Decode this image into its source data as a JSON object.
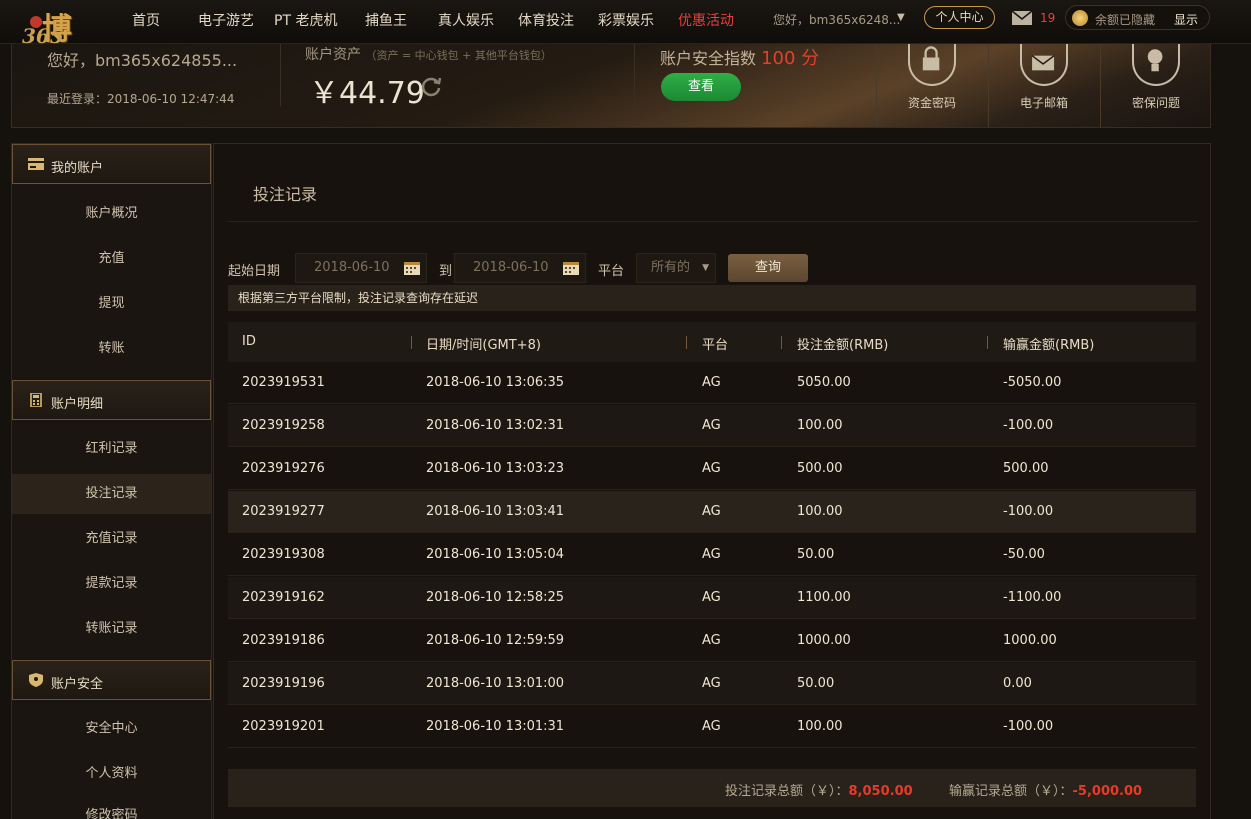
{
  "logo": {
    "big": "博",
    "small": "365"
  },
  "nav": {
    "items": [
      "首页",
      "电子游艺",
      "PT 老虎机",
      "捕鱼王",
      "真人娱乐",
      "体育投注",
      "彩票娱乐",
      "优惠活动"
    ],
    "greeting": "您好，bm365x6248...",
    "personal_center": "个人中心",
    "mail_count": "19",
    "balance_hidden": "余额已隐藏",
    "show_label": "显示"
  },
  "account": {
    "hello": "您好，bm365x624855...",
    "last_login": "最近登录：2018-06-10 12:47:44",
    "assets_label": "账户资产",
    "assets_sub": "（资产 = 中心钱包 + 其他平台钱包）",
    "amount": "￥44.79",
    "safety_label": "账户安全指数",
    "safety_score": "100 分",
    "check_button": "查看",
    "panels": [
      "资金密码",
      "电子邮箱",
      "密保问题"
    ]
  },
  "sidebar": {
    "sections": [
      {
        "title": "我的账户",
        "items": [
          "账户概况",
          "充值",
          "提现",
          "转账"
        ]
      },
      {
        "title": "账户明细",
        "items": [
          "红利记录",
          "投注记录",
          "充值记录",
          "提款记录",
          "转账记录"
        ]
      },
      {
        "title": "账户安全",
        "items": [
          "安全中心",
          "个人资料",
          "修改密码"
        ]
      }
    ],
    "active_item": "投注记录"
  },
  "main": {
    "title": "投注记录",
    "filter": {
      "start_label": "起始日期",
      "start_value": "2018-06-10",
      "to_label": "到",
      "end_value": "2018-06-10",
      "platform_label": "平台",
      "platform_value": "所有的",
      "query_button": "查询"
    },
    "notice": "根据第三方平台限制，投注记录查询存在延迟",
    "columns": [
      "ID",
      "日期/时间(GMT+8)",
      "平台",
      "投注金额(RMB)",
      "输赢金额(RMB)"
    ],
    "rows": [
      [
        "2023919531",
        "2018-06-10 13:06:35",
        "AG",
        "5050.00",
        "-5050.00"
      ],
      [
        "2023919258",
        "2018-06-10 13:02:31",
        "AG",
        "100.00",
        "-100.00"
      ],
      [
        "2023919276",
        "2018-06-10 13:03:23",
        "AG",
        "500.00",
        "500.00"
      ],
      [
        "2023919277",
        "2018-06-10 13:03:41",
        "AG",
        "100.00",
        "-100.00"
      ],
      [
        "2023919308",
        "2018-06-10 13:05:04",
        "AG",
        "50.00",
        "-50.00"
      ],
      [
        "2023919162",
        "2018-06-10 12:58:25",
        "AG",
        "1100.00",
        "-1100.00"
      ],
      [
        "2023919186",
        "2018-06-10 12:59:59",
        "AG",
        "1000.00",
        "1000.00"
      ],
      [
        "2023919196",
        "2018-06-10 13:01:00",
        "AG",
        "50.00",
        "0.00"
      ],
      [
        "2023919201",
        "2018-06-10 13:01:31",
        "AG",
        "100.00",
        "-100.00"
      ]
    ],
    "summary": {
      "bet_label": "投注记录总额（￥）：",
      "bet_total": "8,050.00",
      "win_label": "输赢记录总额（￥）：",
      "win_total": "-5,000.00"
    }
  },
  "colors": {
    "accent_gold": "#c79a4a",
    "promo_red": "#e8403a",
    "check_green": "#2fae46",
    "total_red": "#e83a2a"
  },
  "icons": [
    "logo-ball-icon",
    "chevron-down-icon",
    "mail-icon",
    "coin-icon",
    "refresh-icon",
    "lock-icon",
    "envelope-icon",
    "bulb-icon",
    "card-icon",
    "calculator-icon",
    "shield-icon",
    "calendar-icon"
  ]
}
